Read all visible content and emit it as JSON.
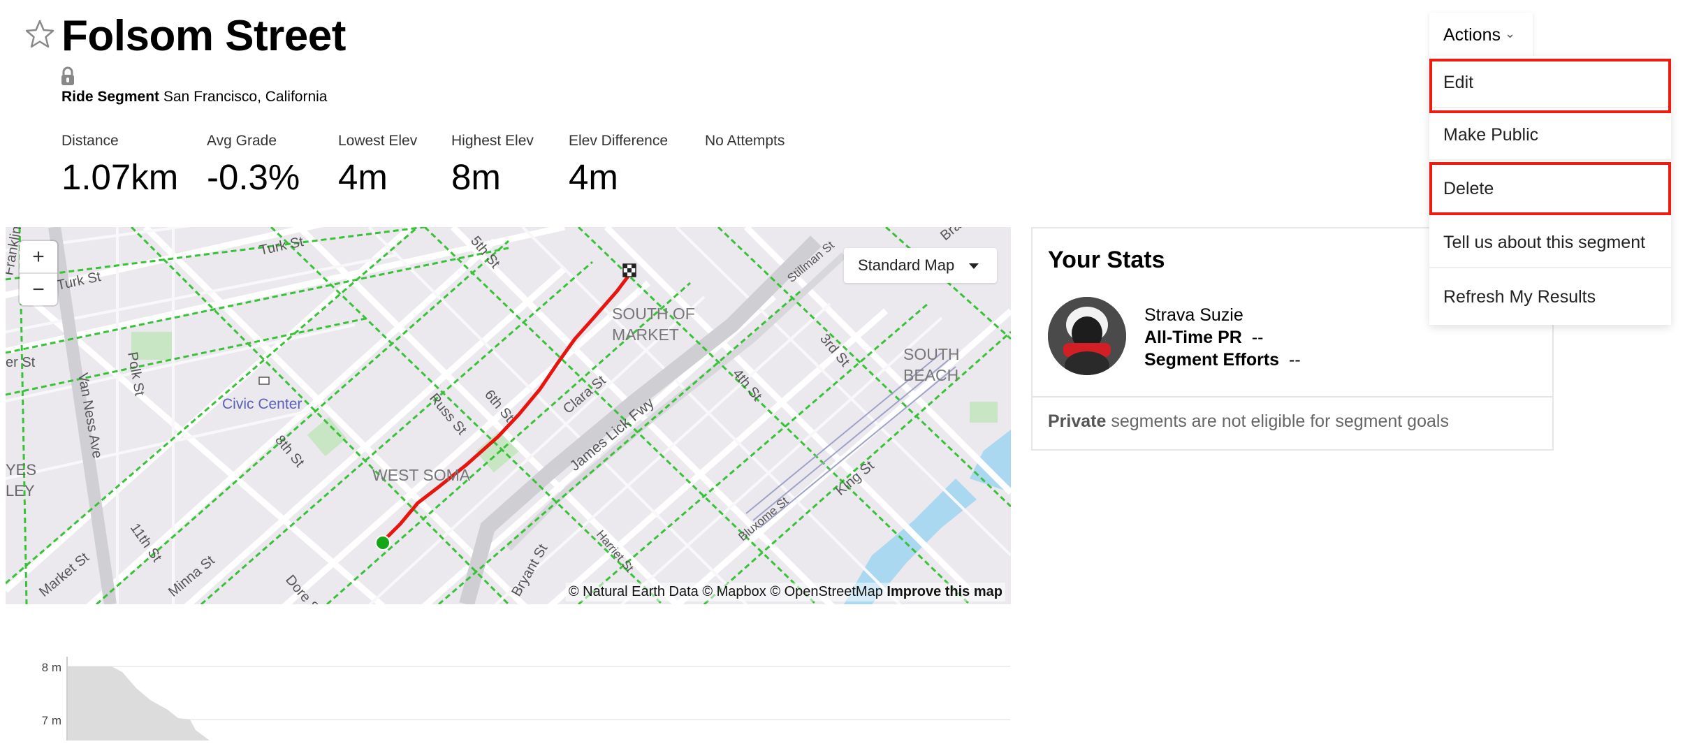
{
  "header": {
    "title": "Folsom Street",
    "segment_type": "Ride Segment",
    "location": "San Francisco, California"
  },
  "stats": [
    {
      "label": "Distance",
      "value": "1.07km"
    },
    {
      "label": "Avg Grade",
      "value": "-0.3%"
    },
    {
      "label": "Lowest Elev",
      "value": "4m"
    },
    {
      "label": "Highest Elev",
      "value": "8m"
    },
    {
      "label": "Elev Difference",
      "value": "4m"
    },
    {
      "label": "No Attempts",
      "value": ""
    }
  ],
  "map": {
    "map_type": "Standard Map",
    "zoom_in": "+",
    "zoom_out": "−",
    "attribution": "© Natural Earth Data © Mapbox © OpenStreetMap",
    "improve_link": "Improve this map",
    "labels": [
      "Turk St",
      "Turk St",
      "Franklin St",
      "er St",
      "Polk St",
      "Van Ness Ave",
      "Civic Center",
      "YES",
      "LEY",
      "Market St",
      "11th St",
      "Minna St",
      "Dore St",
      "8th St",
      "Russ St",
      "WEST SOMA",
      "6th St",
      "Clara St",
      "5th St",
      "4th St",
      "SOUTH OF",
      "MARKET",
      "James Lick Fwy",
      "3rd St",
      "Stillman St",
      "SOUTH",
      "BEACH",
      "Bluxome St",
      "Harriet St",
      "King St",
      "Bryant St",
      "Bra"
    ],
    "route_color": "#e8150f",
    "start_color": "#14a614",
    "bike_lane_color": "#38c238"
  },
  "your_stats": {
    "title": "Your Stats",
    "athlete_name": "Strava Suzie",
    "pr_label": "All-Time PR",
    "pr_value": "--",
    "efforts_label": "Segment Efforts",
    "efforts_value": "--",
    "footer_bold": "Private",
    "footer_text": " segments are not eligible for segment goals"
  },
  "actions": {
    "label": "Actions",
    "items": [
      "Edit",
      "Make Public",
      "Delete",
      "Tell us about this segment",
      "Refresh My Results"
    ],
    "highlight_color": "#ee1c0e"
  },
  "elevation": {
    "y_ticks": [
      "8 m",
      "7 m"
    ]
  }
}
